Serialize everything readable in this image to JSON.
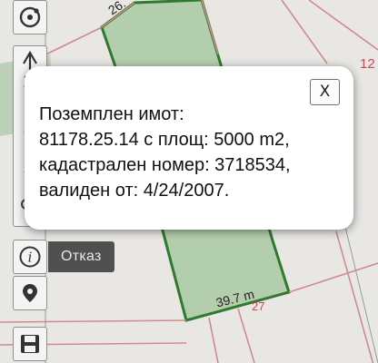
{
  "map": {
    "edge_label_top": "26.",
    "edge_label_bottom": "39.7 m",
    "parcel_number_right": "12",
    "parcel_number_bottom": "27",
    "colors": {
      "background": "#e9e7e4",
      "parcel_fill": "#a8c8a0",
      "parcel_outline": "#2f7a2f",
      "boundary_red": "#d08a8e"
    }
  },
  "toolbar": {
    "items": [
      {
        "name": "compass-icon"
      },
      {
        "name": "measure-icon"
      },
      {
        "name": "info-icon"
      },
      {
        "name": "location-pin-icon"
      },
      {
        "name": "save-icon"
      }
    ]
  },
  "tooltip": {
    "cancel_label": "Отказ"
  },
  "popup": {
    "close_label": "X",
    "lines": [
      "Поземплен имот:",
      "81178.25.14 с площ: 5000 m2,",
      "кадастрален номер: 3718534,",
      "валиден от: 4/24/2007."
    ]
  }
}
